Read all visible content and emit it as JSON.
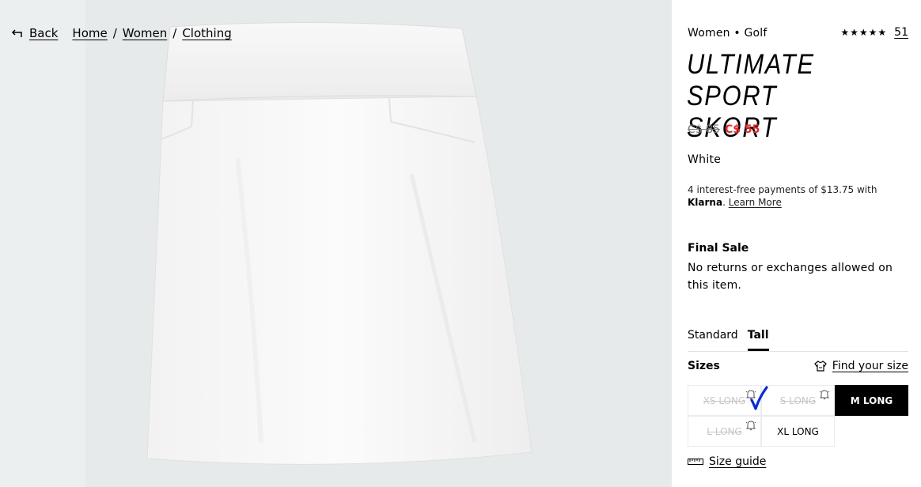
{
  "breadcrumb": {
    "back": "Back",
    "items": [
      "Home",
      "Women",
      "Clothing"
    ],
    "separator": "/"
  },
  "product": {
    "category": "Women • Golf",
    "rating_stars": "★★★★★",
    "rating_value": 5,
    "review_count": "51",
    "title_line1": "ULTIMATE SPORT",
    "title_line2": "SKORT",
    "price_old": "C$ 85",
    "price_new": "C$ 55",
    "color": "White"
  },
  "klarna": {
    "text": "4 interest-free payments of $13.75 with",
    "brand": "Klarna",
    "link": "Learn More"
  },
  "final_sale": {
    "title": "Final Sale",
    "body": "No returns or exchanges allowed on this item."
  },
  "fit_tabs": [
    {
      "label": "Standard",
      "active": false
    },
    {
      "label": "Tall",
      "active": true
    }
  ],
  "sizes": {
    "label": "Sizes",
    "find_size": "Find your size",
    "options": [
      {
        "label": "XS LONG",
        "state": "unavailable"
      },
      {
        "label": "S LONG",
        "state": "unavailable"
      },
      {
        "label": "M LONG",
        "state": "selected"
      },
      {
        "label": "L LONG",
        "state": "unavailable"
      },
      {
        "label": "XL LONG",
        "state": "available"
      }
    ],
    "guide": "Size guide"
  },
  "icons": {
    "back": "back-arrow-icon",
    "find_size": "tshirt-icon",
    "notify": "bell-icon",
    "size_guide": "ruler-icon",
    "annotation": "checkmark-annotation"
  },
  "colors": {
    "sale": "#e32b2b",
    "image_bg": "#eceff0",
    "check": "#0a2bd6"
  }
}
